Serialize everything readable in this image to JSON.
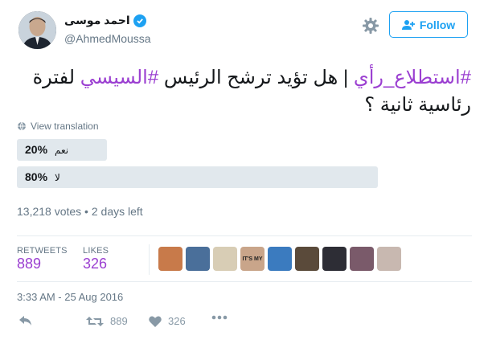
{
  "user": {
    "display_name": "احمد موسى",
    "handle": "@AhmedMoussa"
  },
  "header": {
    "follow_label": "Follow"
  },
  "tweet": {
    "hashtag_poll": "#استطلاع_رأي",
    "text_part1": " | هل تؤيد ترشح الرئيس ",
    "hashtag_sisi": "#السيسي",
    "text_part2": " لفترة رئاسية ثانية ؟",
    "view_translation": "View translation"
  },
  "poll": {
    "options": [
      {
        "label": "نعم",
        "percent": 20,
        "percent_text": "20%"
      },
      {
        "label": "لا",
        "percent": 80,
        "percent_text": "80%"
      }
    ],
    "summary": "13,218 votes • 2 days left"
  },
  "stats": {
    "retweets_label": "RETWEETS",
    "retweets_value": "889",
    "likes_label": "LIKES",
    "likes_value": "326",
    "likers": [
      {
        "color": "#c87a4a"
      },
      {
        "color": "#4a6f9a"
      },
      {
        "color": "#d8cdb5"
      },
      {
        "color": "#c9a58a"
      },
      {
        "color": "#3b7bbf"
      },
      {
        "color": "#5a4a3a"
      },
      {
        "color": "#2d2d35"
      },
      {
        "color": "#7a5a6a"
      },
      {
        "color": "#c8b8b0"
      }
    ],
    "liker_badge_text": "IT'S MY"
  },
  "timestamp": "3:33 AM - 25 Aug 2016",
  "actions": {
    "retweet_count": "889",
    "like_count": "326"
  },
  "colors": {
    "accent_blue": "#1da1f2",
    "hashtag_purple": "#9b3fd1",
    "muted": "#657786",
    "poll_bar": "#e1e8ed"
  }
}
